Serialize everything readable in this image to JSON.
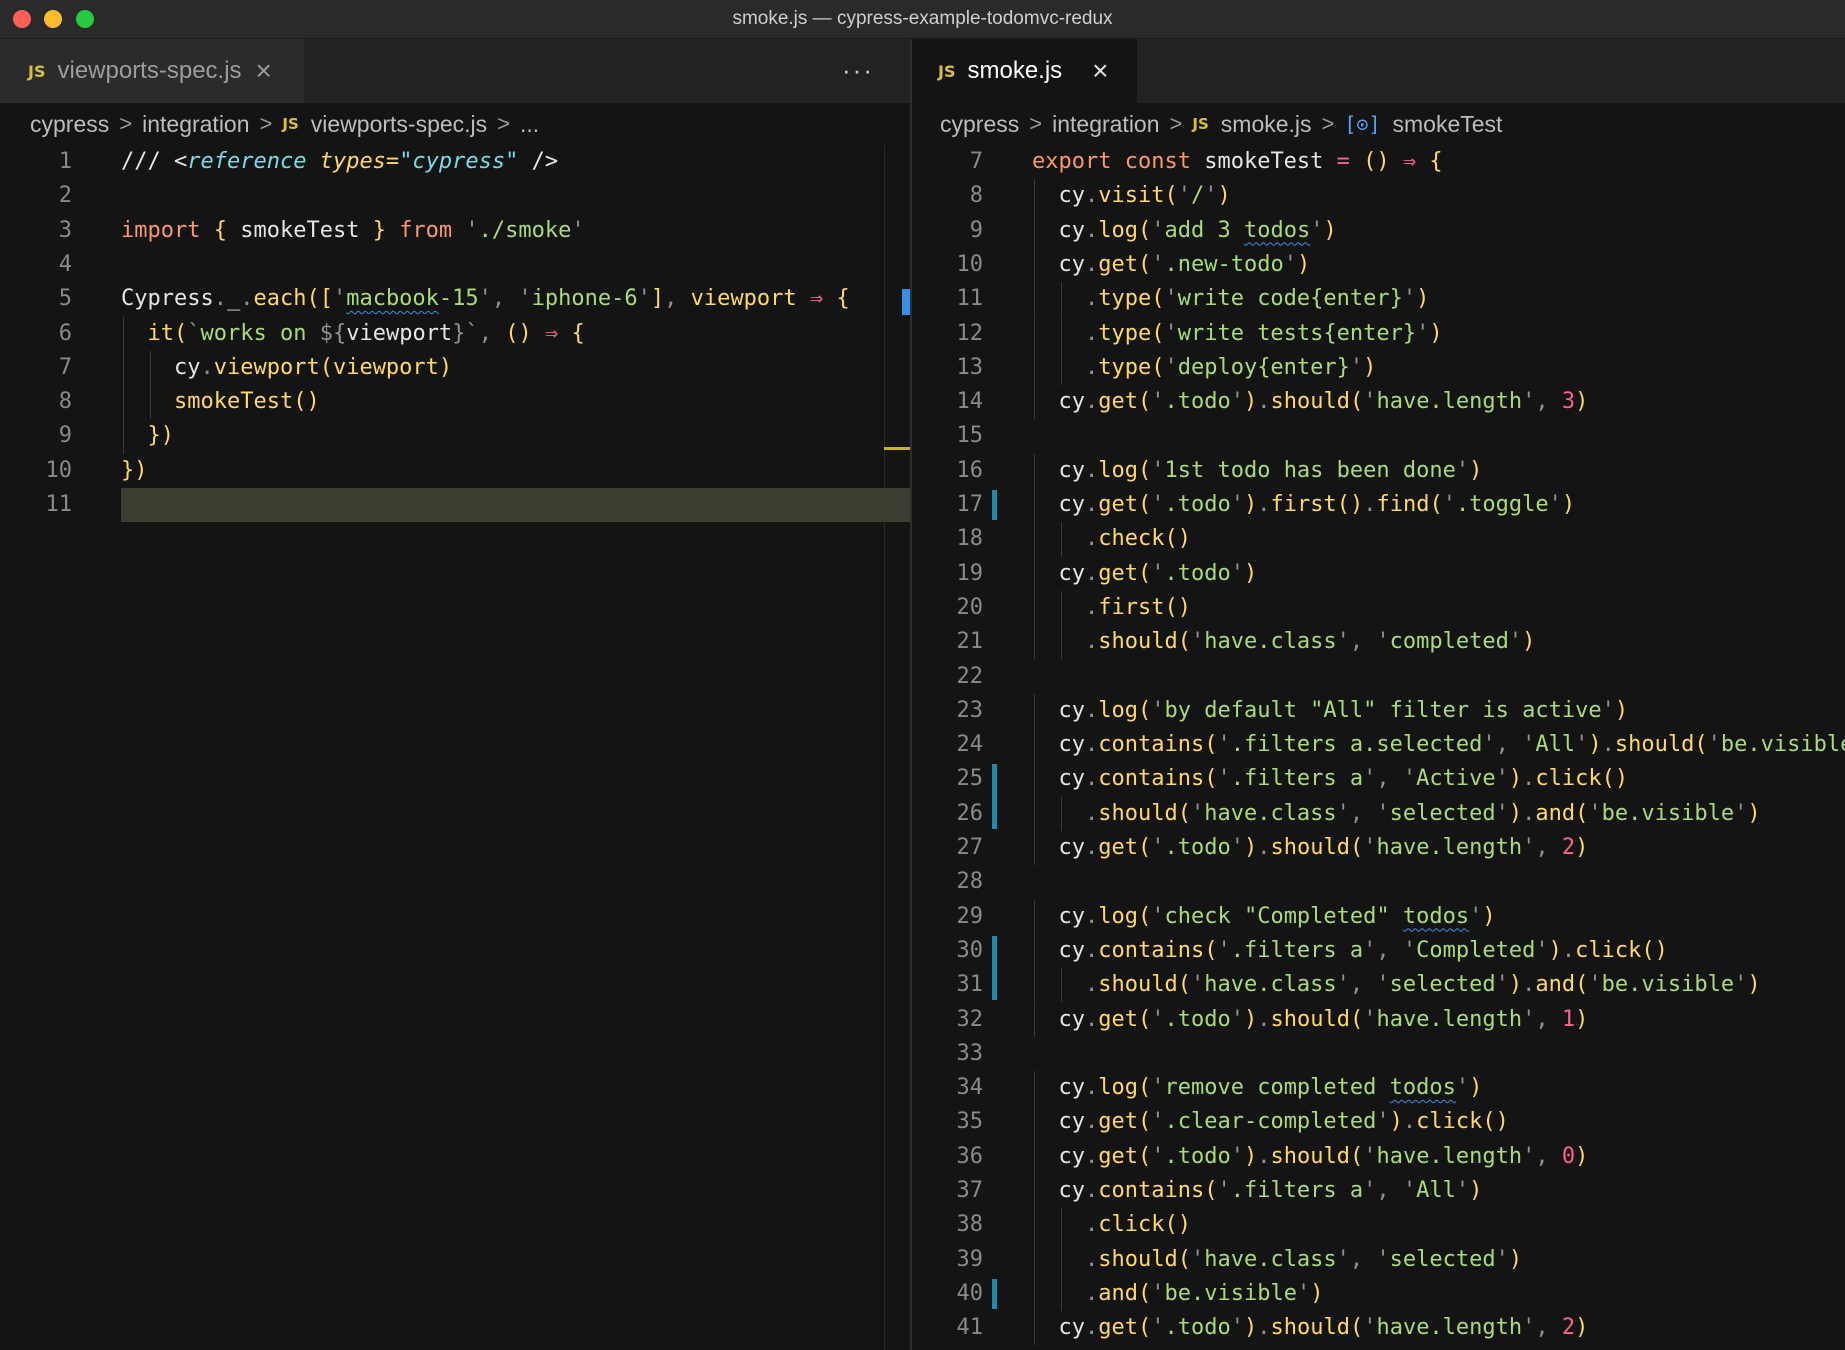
{
  "window": {
    "title": "smoke.js — cypress-example-todomvc-redux",
    "colors": {
      "close": "#fe5f57",
      "minimize": "#febc2e",
      "maximize": "#28c840"
    }
  },
  "left": {
    "tab": {
      "badge": "JS",
      "label": "viewports-spec.js",
      "close": "×"
    },
    "more": "···",
    "breadcrumb": [
      "cypress",
      "integration",
      "viewports-spec.js",
      "..."
    ],
    "lines": [
      {
        "n": "1",
        "t": "/// <reference types=\"cypress\" />"
      },
      {
        "n": "2",
        "t": ""
      },
      {
        "n": "3",
        "t": "import { smokeTest } from './smoke'"
      },
      {
        "n": "4",
        "t": ""
      },
      {
        "n": "5",
        "t": "Cypress._.each(['macbook-15', 'iphone-6'], viewport ⇒ {"
      },
      {
        "n": "6",
        "t": "  it(`works on ${viewport}`, () ⇒ {"
      },
      {
        "n": "7",
        "t": "    cy.viewport(viewport)"
      },
      {
        "n": "8",
        "t": "    smokeTest()"
      },
      {
        "n": "9",
        "t": "  })"
      },
      {
        "n": "10",
        "t": "})"
      },
      {
        "n": "11",
        "t": ""
      }
    ]
  },
  "right": {
    "tab": {
      "badge": "JS",
      "label": "smoke.js",
      "close": "×"
    },
    "breadcrumb": [
      "cypress",
      "integration",
      "smoke.js",
      "smokeTest"
    ],
    "lines": [
      {
        "n": "7",
        "t": "export const smokeTest = () ⇒ {"
      },
      {
        "n": "8",
        "t": "  cy.visit('/')"
      },
      {
        "n": "9",
        "t": "  cy.log('add 3 todos')"
      },
      {
        "n": "10",
        "t": "  cy.get('.new-todo')"
      },
      {
        "n": "11",
        "t": "    .type('write code{enter}')"
      },
      {
        "n": "12",
        "t": "    .type('write tests{enter}')"
      },
      {
        "n": "13",
        "t": "    .type('deploy{enter}')"
      },
      {
        "n": "14",
        "t": "  cy.get('.todo').should('have.length', 3)"
      },
      {
        "n": "15",
        "t": ""
      },
      {
        "n": "16",
        "t": "  cy.log('1st todo has been done')"
      },
      {
        "n": "17",
        "t": "  cy.get('.todo').first().find('.toggle')"
      },
      {
        "n": "18",
        "t": "    .check()"
      },
      {
        "n": "19",
        "t": "  cy.get('.todo')"
      },
      {
        "n": "20",
        "t": "    .first()"
      },
      {
        "n": "21",
        "t": "    .should('have.class', 'completed')"
      },
      {
        "n": "22",
        "t": ""
      },
      {
        "n": "23",
        "t": "  cy.log('by default \"All\" filter is active')"
      },
      {
        "n": "24",
        "t": "  cy.contains('.filters a.selected', 'All').should('be.visible')"
      },
      {
        "n": "25",
        "t": "  cy.contains('.filters a', 'Active').click()"
      },
      {
        "n": "26",
        "t": "    .should('have.class', 'selected').and('be.visible')"
      },
      {
        "n": "27",
        "t": "  cy.get('.todo').should('have.length', 2)"
      },
      {
        "n": "28",
        "t": ""
      },
      {
        "n": "29",
        "t": "  cy.log('check \"Completed\" todos')"
      },
      {
        "n": "30",
        "t": "  cy.contains('.filters a', 'Completed').click()"
      },
      {
        "n": "31",
        "t": "    .should('have.class', 'selected').and('be.visible')"
      },
      {
        "n": "32",
        "t": "  cy.get('.todo').should('have.length', 1)"
      },
      {
        "n": "33",
        "t": ""
      },
      {
        "n": "34",
        "t": "  cy.log('remove completed todos')"
      },
      {
        "n": "35",
        "t": "  cy.get('.clear-completed').click()"
      },
      {
        "n": "36",
        "t": "  cy.get('.todo').should('have.length', 0)"
      },
      {
        "n": "37",
        "t": "  cy.contains('.filters a', 'All')"
      },
      {
        "n": "38",
        "t": "    .click()"
      },
      {
        "n": "39",
        "t": "    .should('have.class', 'selected')"
      },
      {
        "n": "40",
        "t": "    .and('be.visible')"
      },
      {
        "n": "41",
        "t": "  cy.get('.todo').should('have.length', 2)"
      }
    ]
  }
}
